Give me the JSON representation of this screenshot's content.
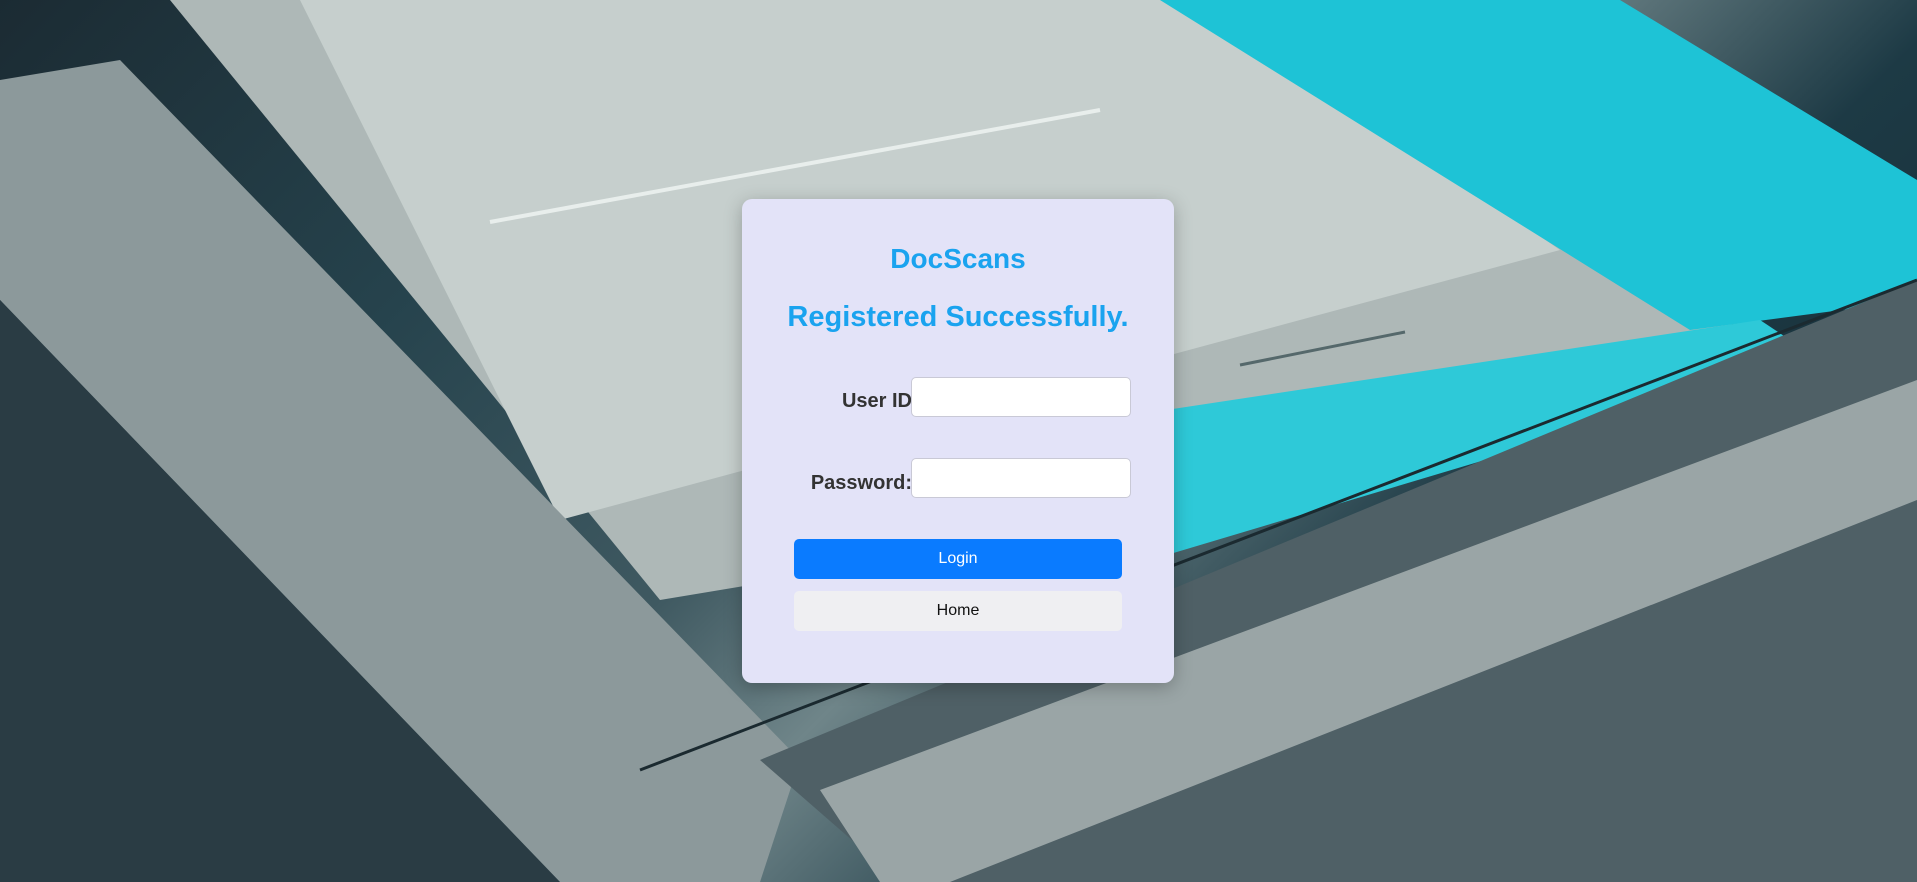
{
  "brand": "DocScans",
  "message": "Registered Successfully.",
  "form": {
    "user_id_label": "User ID",
    "user_id_value": "",
    "password_label": "Password:",
    "password_value": ""
  },
  "buttons": {
    "login": "Login",
    "home": "Home"
  },
  "colors": {
    "accent": "#1aa3ef",
    "login_button": "#0a7bff",
    "card_background": "#e3e3f8"
  }
}
